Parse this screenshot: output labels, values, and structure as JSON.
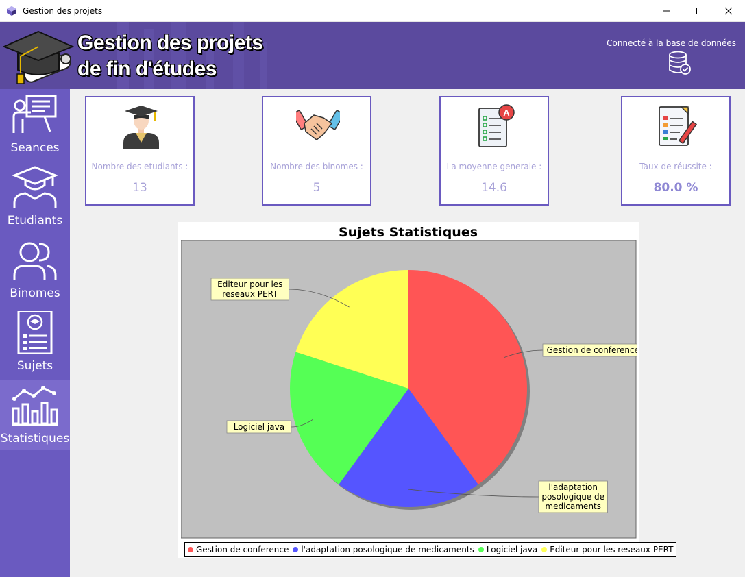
{
  "window": {
    "title": "Gestion des projets"
  },
  "header": {
    "title_line1": "Gestion des projets",
    "title_line2": "de fin d'études",
    "db_status": "Connecté à la base de données"
  },
  "sidebar": {
    "items": [
      {
        "label": "Seances",
        "icon": "presentation-icon",
        "active": false
      },
      {
        "label": "Etudiants",
        "icon": "graduate-icon",
        "active": false
      },
      {
        "label": "Binomes",
        "icon": "users-icon",
        "active": false
      },
      {
        "label": "Sujets",
        "icon": "document-icon",
        "active": false
      },
      {
        "label": "Statistiques",
        "icon": "chart-icon",
        "active": true
      }
    ]
  },
  "cards": [
    {
      "label": "Nombre des etudiants :",
      "value": "13",
      "icon": "student-icon"
    },
    {
      "label": "Nombre des binomes :",
      "value": "5",
      "icon": "handshake-icon"
    },
    {
      "label": "La moyenne generale :",
      "value": "14.6",
      "icon": "grade-icon"
    },
    {
      "label": "Taux de réussite :",
      "value": "80.0 %",
      "icon": "checklist-icon"
    }
  ],
  "colors": {
    "header": "#5b4a9e",
    "sidebar": "#6a5ac0",
    "accent": "#8f88d4"
  },
  "chart_data": {
    "type": "pie",
    "title": "Sujets Statistiques",
    "categories": [
      "Gestion de conference",
      "l'adaptation posologique de medicaments",
      "Logiciel java",
      "Editeur pour les reseaux PERT"
    ],
    "values": [
      40,
      20,
      20,
      20
    ],
    "colors": [
      "#ff5555",
      "#5555ff",
      "#55ff55",
      "#ffff55"
    ],
    "slice_labels": [
      "Gestion de conference",
      "l'adaptation posologique de medicaments",
      "Logiciel java",
      "Editeur pour les reseaux PERT"
    ],
    "legend": "bottom"
  }
}
